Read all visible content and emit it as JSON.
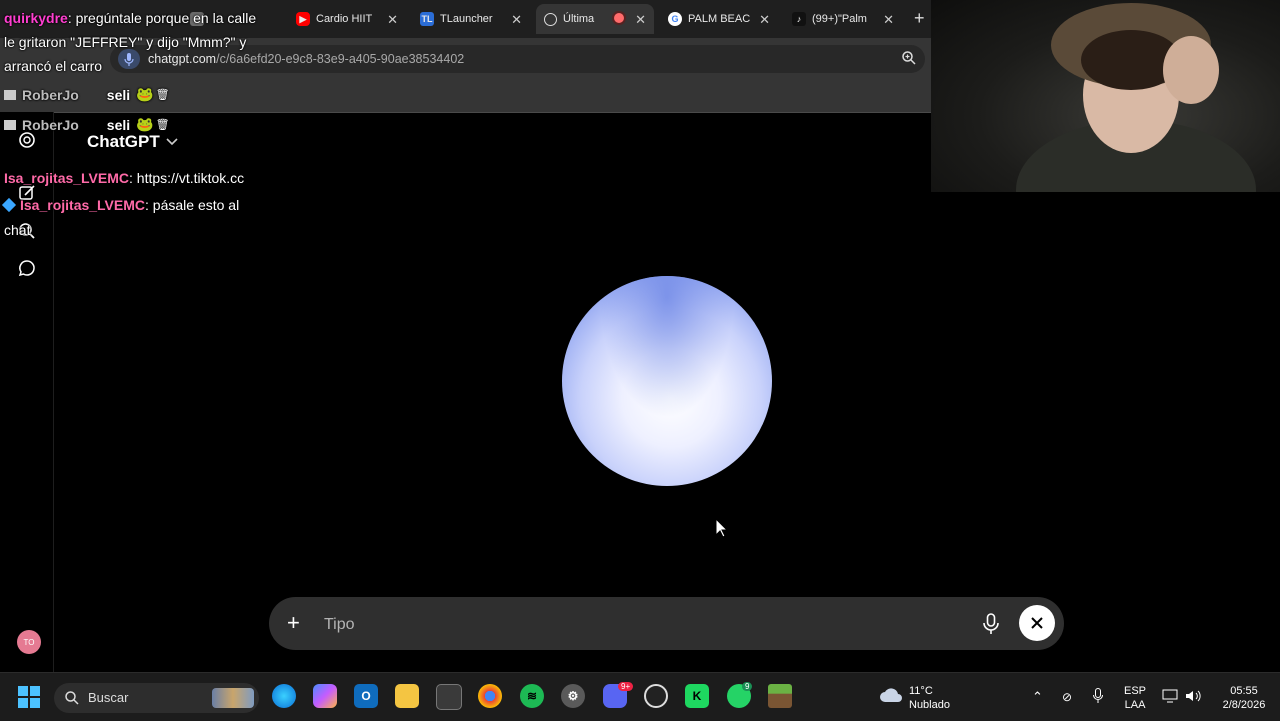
{
  "browser": {
    "tabs": [
      {
        "label": "",
        "favicon": "chat-icon",
        "color": "#6a6a6a"
      },
      {
        "label": "Cardio HIIT",
        "favicon": "youtube-icon",
        "color": "#ff0000"
      },
      {
        "label": "TLauncher",
        "favicon": "tlauncher-icon",
        "color": "#2b6dd6",
        "glyph": "TL"
      },
      {
        "label": "Última",
        "favicon": "chatgpt-icon",
        "color": "#3a3a3a",
        "active": true
      },
      {
        "label": "PALM BEAC",
        "favicon": "google-icon",
        "color": "#ffffff"
      },
      {
        "label": "(99+)\"Palm",
        "favicon": "tiktok-icon",
        "color": "#111111"
      }
    ],
    "url_domain": "chatgpt.com",
    "url_path": "/c/6a6efd20-e9c8-83e9-a405-90ae38534402"
  },
  "chat_overlay": {
    "line1_user": "quirkydre",
    "line1_text": ": pregúntale porque en la calle",
    "line1_cont1": "le gritaron \"JEFFREY\" y dijo \"Mmm?\" y",
    "line1_cont2": "arrancó el carro",
    "line2_user": "RoberJo",
    "line2_text": "seli",
    "line3_user": "RoberJo",
    "line3_text": "seli",
    "line4_user": "Isa_rojitas_LVEMC",
    "line4_text": ": https://vt.tiktok.cc",
    "line5_user": "Isa_rojitas_LVEMC",
    "line5_text": ": pásale esto al",
    "line5_cont": "chat"
  },
  "chatgpt": {
    "model_label": "ChatGPT",
    "composer_placeholder": "Tipo",
    "avatar_initials": "TO"
  },
  "taskbar": {
    "search_label": "Buscar",
    "weather_temp": "11°C",
    "weather_desc": "Nublado",
    "lang_top": "ESP",
    "lang_bottom": "LAA",
    "time": "05:55",
    "date": "2/8/2026",
    "discord_badge": "9+",
    "whatsapp_badge": "9"
  },
  "colors": {
    "accent_orb": "#8ea3f0",
    "composer_bg": "#2f2f2f",
    "chat_user_pink": "#ff3fd0"
  }
}
